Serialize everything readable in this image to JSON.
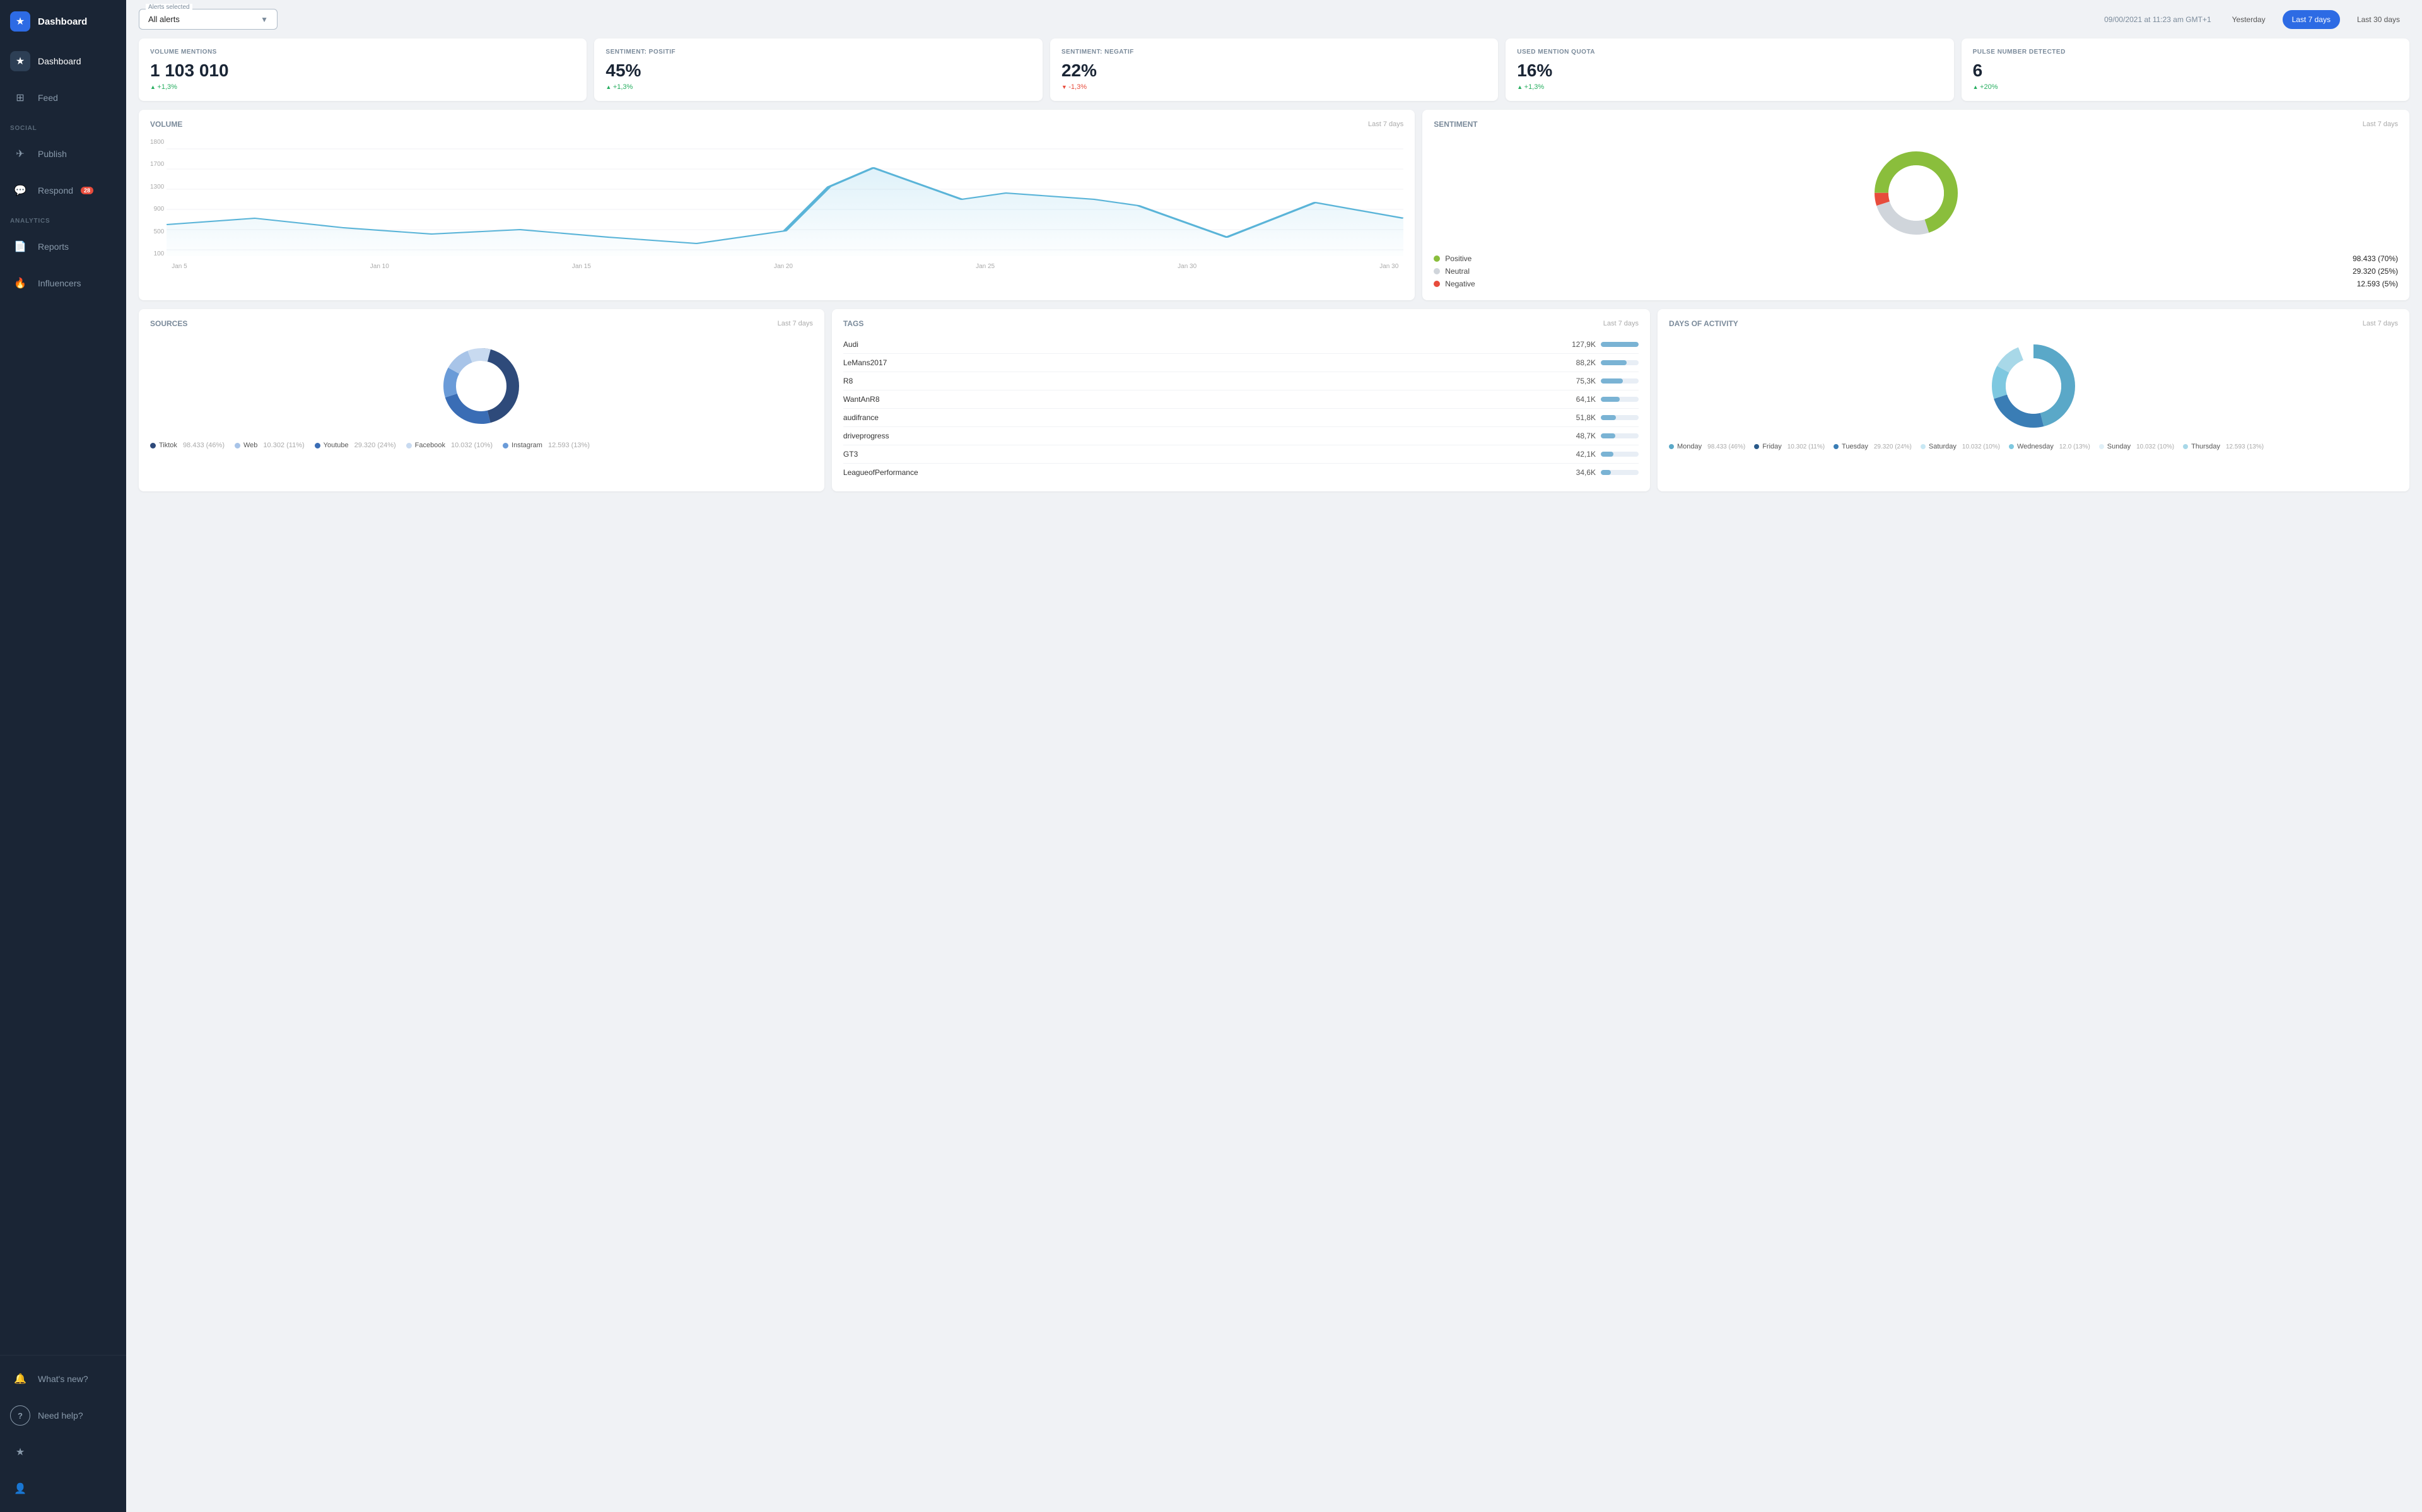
{
  "sidebar": {
    "logo": {
      "text": "Dashboard"
    },
    "items": [
      {
        "id": "dashboard",
        "label": "Dashboard",
        "icon": "★",
        "active": true,
        "section": null
      },
      {
        "id": "feed",
        "label": "Feed",
        "icon": "⊞",
        "active": false,
        "section": null
      }
    ],
    "sections": [
      {
        "label": "SOCIAL",
        "items": [
          {
            "id": "publish",
            "label": "Publish",
            "icon": "✈",
            "active": false,
            "badge": null
          },
          {
            "id": "respond",
            "label": "Respond",
            "icon": "💬",
            "active": false,
            "badge": "28"
          }
        ]
      },
      {
        "label": "ANALYTICS",
        "items": [
          {
            "id": "reports",
            "label": "Reports",
            "icon": "📄",
            "active": false,
            "badge": null
          },
          {
            "id": "influencers",
            "label": "Influencers",
            "icon": "🔥",
            "active": false,
            "badge": null
          }
        ]
      }
    ],
    "bottom": [
      {
        "id": "whats-new",
        "label": "What's new?",
        "icon": "🔔",
        "badge": null
      },
      {
        "id": "need-help",
        "label": "Need help?",
        "icon": "?",
        "badge": null
      },
      {
        "id": "favorites",
        "label": "",
        "icon": "★",
        "badge": null
      },
      {
        "id": "profile",
        "label": "",
        "icon": "👤",
        "badge": null
      }
    ]
  },
  "topbar": {
    "alerts_label": "Alerts selected",
    "alerts_value": "All alerts",
    "date_text": "09/00/2021 at 11:23 am GMT+1",
    "time_buttons": [
      {
        "label": "Yesterday",
        "active": false
      },
      {
        "label": "Last 7 days",
        "active": true
      },
      {
        "label": "Last 30 days",
        "active": false
      }
    ]
  },
  "stats": [
    {
      "label": "VOLUME MENTIONS",
      "value": "1 103 010",
      "change": "+1,3%",
      "direction": "up"
    },
    {
      "label": "SENTIMENT: POSITIF",
      "value": "45%",
      "change": "+1,3%",
      "direction": "up"
    },
    {
      "label": "SENTIMENT: NEGATIF",
      "value": "22%",
      "change": "-1,3%",
      "direction": "down"
    },
    {
      "label": "USED MENTION QUOTA",
      "value": "16%",
      "change": "+1,3%",
      "direction": "up"
    },
    {
      "label": "PULSE NUMBER DETECTED",
      "value": "6",
      "change": "+20%",
      "direction": "up"
    }
  ],
  "volume_chart": {
    "title": "Volume",
    "period": "Last 7 days",
    "y_labels": [
      "1800",
      "1700",
      "1300",
      "900",
      "500",
      "100"
    ],
    "x_labels": [
      "Jan 5",
      "Jan 10",
      "Jan 15",
      "Jan 20",
      "Jan 25",
      "Jan 30",
      "Jan 30"
    ]
  },
  "sentiment_chart": {
    "title": "Sentiment",
    "period": "Last 7 days",
    "segments": [
      {
        "label": "Positive",
        "value": "98.433 (70%)",
        "color": "#8abe3c",
        "percent": 70
      },
      {
        "label": "Neutral",
        "value": "29.320 (25%)",
        "color": "#d0d5db",
        "percent": 25
      },
      {
        "label": "Negative",
        "value": "12.593 (5%)",
        "color": "#e74c3c",
        "percent": 5
      }
    ]
  },
  "sources_chart": {
    "title": "Sources",
    "period": "Last 7 days",
    "segments": [
      {
        "label": "Tiktok",
        "value": "98.433 (46%)",
        "color": "#2e4a7a",
        "percent": 46
      },
      {
        "label": "Youtube",
        "value": "29.320 (24%)",
        "color": "#3a6db5",
        "percent": 24
      },
      {
        "label": "Instagram",
        "value": "12.593 (13%)",
        "color": "#6a9bd8",
        "percent": 13
      },
      {
        "label": "Web",
        "value": "10.302 (11%)",
        "color": "#a8c4e8",
        "percent": 11
      },
      {
        "label": "Facebook",
        "value": "10.032 (10%)",
        "color": "#c8daf0",
        "percent": 10
      }
    ]
  },
  "tags_chart": {
    "title": "Tags",
    "period": "Last 7 days",
    "items": [
      {
        "name": "Audi",
        "value": "127,9K",
        "bar_pct": 100
      },
      {
        "name": "LeMans2017",
        "value": "88,2K",
        "bar_pct": 69
      },
      {
        "name": "R8",
        "value": "75,3K",
        "bar_pct": 59
      },
      {
        "name": "WantAnR8",
        "value": "64,1K",
        "bar_pct": 50
      },
      {
        "name": "audifrance",
        "value": "51,8K",
        "bar_pct": 40
      },
      {
        "name": "driveprogress",
        "value": "48,7K",
        "bar_pct": 38
      },
      {
        "name": "GT3",
        "value": "42,1K",
        "bar_pct": 33
      },
      {
        "name": "LeagueofPerformance",
        "value": "34,6K",
        "bar_pct": 27
      }
    ]
  },
  "activity_chart": {
    "title": "Days of activity",
    "period": "Last 7 days",
    "segments": [
      {
        "label": "Monday",
        "value": "98.433 (46%)",
        "color": "#5aa8c8",
        "percent": 46
      },
      {
        "label": "Tuesday",
        "value": "29.320 (24%)",
        "color": "#3a7db5",
        "percent": 24
      },
      {
        "label": "Wednesday",
        "value": "12.0 (13%)",
        "color": "#7ec8e0",
        "percent": 13
      },
      {
        "label": "Thursday",
        "value": "12.593 (13%)",
        "color": "#a8d8e8",
        "percent": 13
      },
      {
        "label": "Friday",
        "value": "10.302 (11%)",
        "color": "#2a5a8a",
        "percent": 11
      },
      {
        "label": "Saturday",
        "value": "10.032 (10%)",
        "color": "#c8e8f4",
        "percent": 10
      },
      {
        "label": "Sunday",
        "value": "10.032 (10%)",
        "color": "#e0f0f8",
        "percent": 10
      }
    ]
  }
}
